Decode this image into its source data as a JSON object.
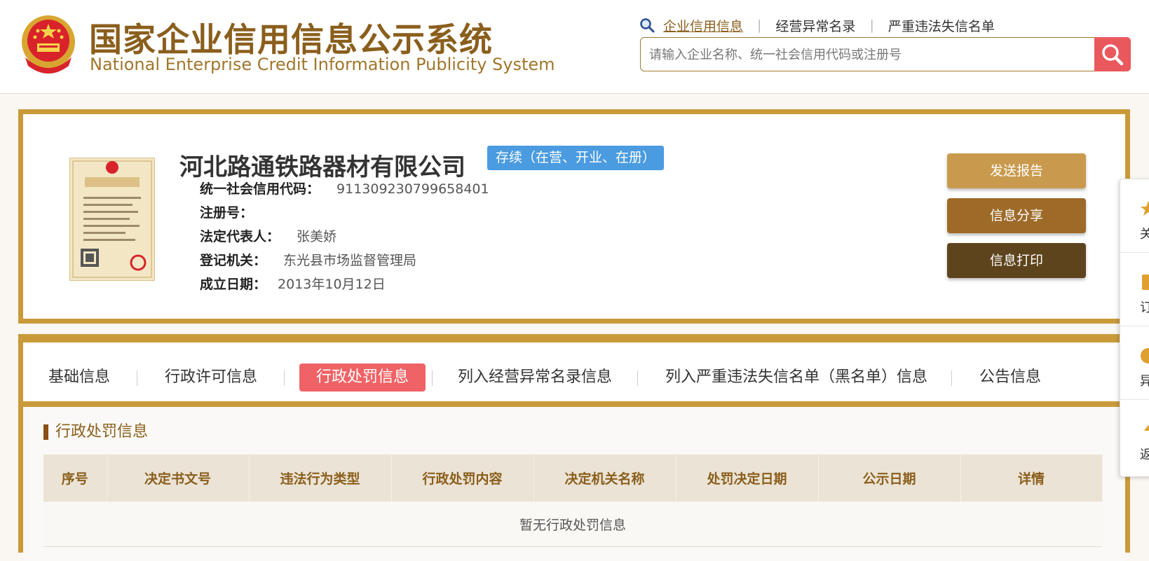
{
  "header": {
    "title_cn": "国家企业信用信息公示系统",
    "title_en": "National Enterprise Credit Information Publicity System",
    "links": [
      "企业信用信息",
      "经营异常名录",
      "严重违法失信名单"
    ],
    "search_placeholder": "请输入企业名称、统一社会信用代码或注册号"
  },
  "company": {
    "name": "河北路通铁路器材有限公司",
    "status": "存续（在营、开业、在册）",
    "credit_code_label": "统一社会信用代码：",
    "credit_code": "911309230799658401",
    "reg_no_label": "注册号：",
    "reg_no": "",
    "legal_rep_label": "法定代表人：",
    "legal_rep": "张美娇",
    "authority_label": "登记机关：",
    "authority": "东光县市场监督管理局",
    "founded_label": "成立日期：",
    "founded": "2013年10月12日"
  },
  "actions": {
    "send_report": "发送报告",
    "share": "信息分享",
    "print": "信息打印"
  },
  "side_toolbar": {
    "items": [
      "关",
      "订",
      "异",
      "返"
    ]
  },
  "tabs": {
    "items": [
      "基础信息",
      "行政许可信息",
      "行政处罚信息",
      "列入经营异常名录信息",
      "列入严重违法失信名单（黑名单）信息",
      "公告信息"
    ],
    "active_index": 2
  },
  "section": {
    "title": "行政处罚信息",
    "columns": [
      "序号",
      "决定书文号",
      "违法行为类型",
      "行政处罚内容",
      "决定机关名称",
      "处罚决定日期",
      "公示日期",
      "详情"
    ],
    "empty_text": "暂无行政处罚信息"
  },
  "colors": {
    "gold_border": "#c99a3a",
    "brand_brown": "#8a5e1c",
    "active_tab": "#ef6366",
    "status_blue": "#4a9be0",
    "search_red": "#e9585c"
  }
}
